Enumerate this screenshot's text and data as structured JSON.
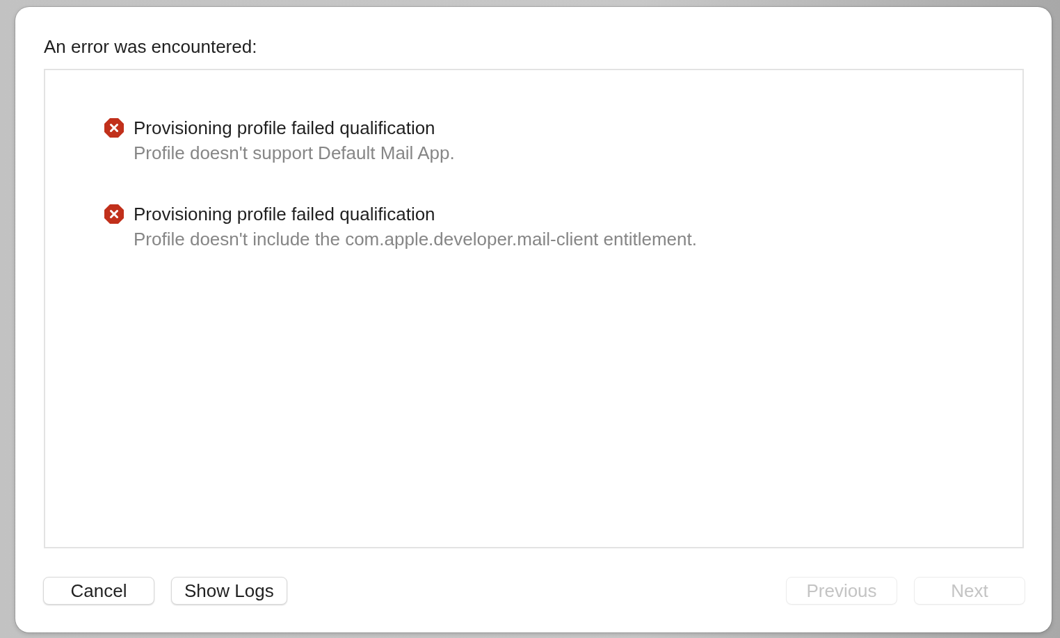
{
  "dialog": {
    "heading": "An error was encountered:",
    "errors": [
      {
        "kind": "error",
        "title": "Provisioning profile failed qualification",
        "detail": "Profile doesn't support Default Mail App."
      },
      {
        "kind": "error",
        "title": "Provisioning profile failed qualification",
        "detail": "Profile doesn't include the com.apple.developer.mail-client entitlement."
      }
    ],
    "buttons_left": [
      {
        "label": "Cancel",
        "disabled": false
      },
      {
        "label": "Show Logs",
        "disabled": false
      }
    ],
    "buttons_right": [
      {
        "label": "Previous",
        "disabled": true
      },
      {
        "label": "Next",
        "disabled": true
      }
    ]
  }
}
